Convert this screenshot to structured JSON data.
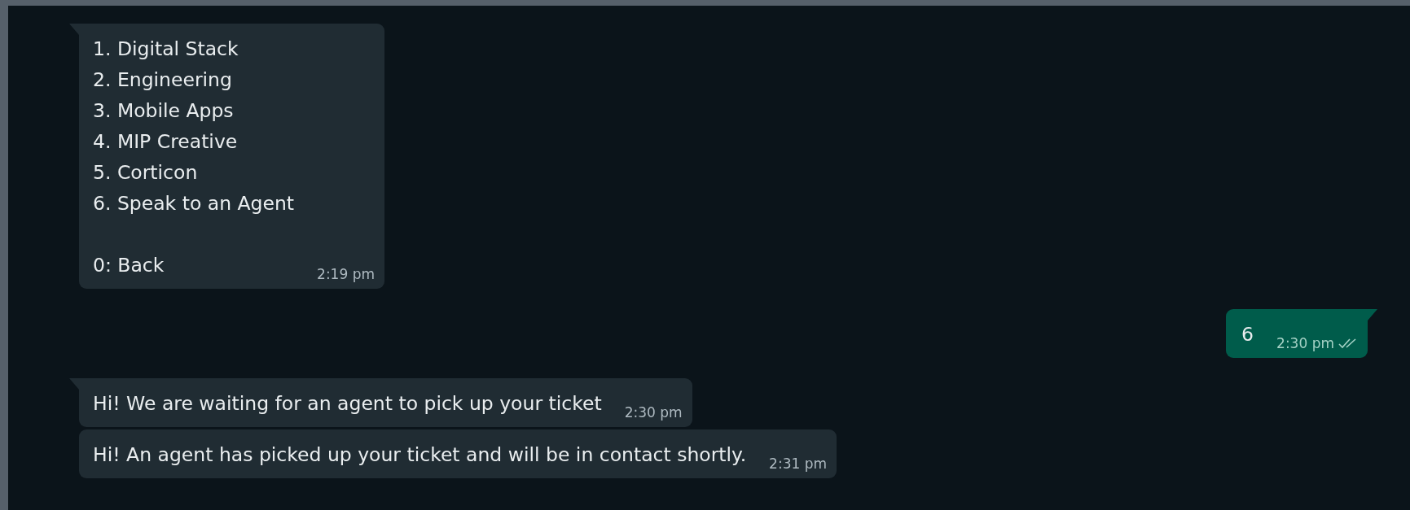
{
  "messages": [
    {
      "kind": "incoming",
      "tail": true,
      "paragraphs": [
        {
          "lines": [
            "1. Digital Stack",
            "2. Engineering",
            "3. Mobile Apps",
            "4. MIP Creative",
            "5. Corticon",
            "6. Speak to an Agent"
          ]
        },
        {
          "lines": [
            "0: Back"
          ]
        }
      ],
      "time": "2:19 pm"
    },
    {
      "kind": "outgoing",
      "tail": true,
      "paragraphs": [
        {
          "lines": [
            "6"
          ]
        }
      ],
      "time": "2:30 pm",
      "read": false
    },
    {
      "kind": "incoming",
      "tail": true,
      "paragraphs": [
        {
          "lines": [
            "Hi! We are waiting for an agent to pick up your ticket"
          ]
        }
      ],
      "time": "2:30 pm"
    },
    {
      "kind": "incoming",
      "tail": false,
      "paragraphs": [
        {
          "lines": [
            "Hi! An agent has picked up your ticket and will be in contact shortly."
          ]
        }
      ],
      "time": "2:31 pm"
    }
  ]
}
